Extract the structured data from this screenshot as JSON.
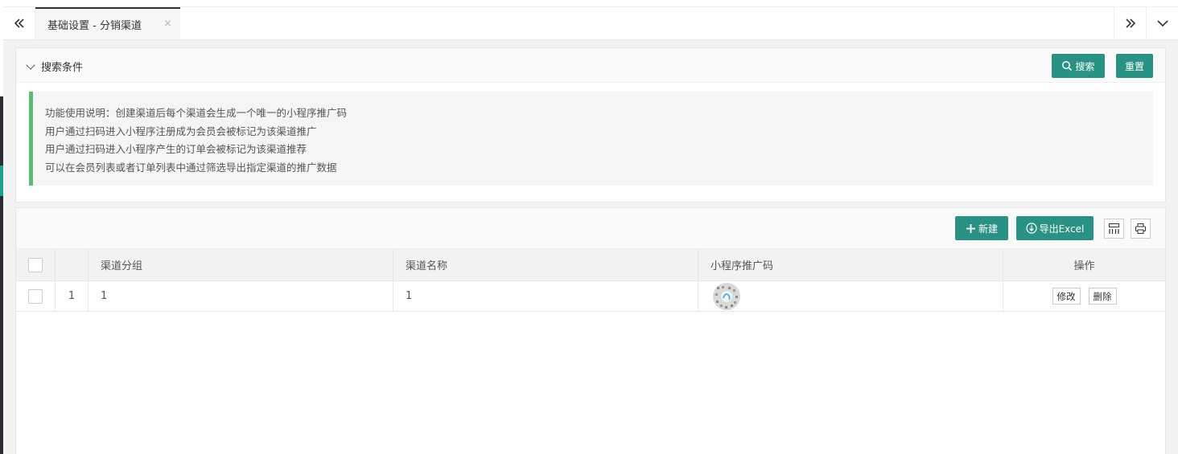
{
  "tabs": {
    "active_label": "基础设置 - 分销渠道",
    "close_glyph": "×",
    "prev_glyph": "«",
    "next_glyph": "»"
  },
  "search": {
    "title": "搜索条件",
    "search_button": "搜索",
    "reset_button": "重置"
  },
  "notice": {
    "lines": [
      "功能使用说明：创建渠道后每个渠道会生成一个唯一的小程序推广码",
      "用户通过扫码进入小程序注册成为会员会被标记为该渠道推广",
      "用户通过扫码进入小程序产生的订单会被标记为该渠道推荐",
      "可以在会员列表或者订单列表中通过筛选导出指定渠道的推广数据"
    ]
  },
  "toolbar": {
    "add_button": "新建",
    "export_button": "导出Excel"
  },
  "table": {
    "headers": {
      "group": "渠道分组",
      "name": "渠道名称",
      "qrcode": "小程序推广码",
      "action": "操作"
    },
    "rows": [
      {
        "index": "1",
        "group": "1",
        "name": "1",
        "edit": "修改",
        "delete": "删除"
      }
    ]
  },
  "colors": {
    "primary": "#2a9185",
    "notice_border": "#5fb878",
    "sidebar_dark": "#2b2e35",
    "sidebar_accent": "#1aa094"
  },
  "icons": {
    "tab_prev": "double-chevron-left-icon",
    "tab_next": "double-chevron-right-icon",
    "tab_menu": "chevron-down-icon",
    "search": "search-icon",
    "add": "plus-icon",
    "export": "download-icon",
    "columns": "columns-icon",
    "print": "print-icon"
  }
}
